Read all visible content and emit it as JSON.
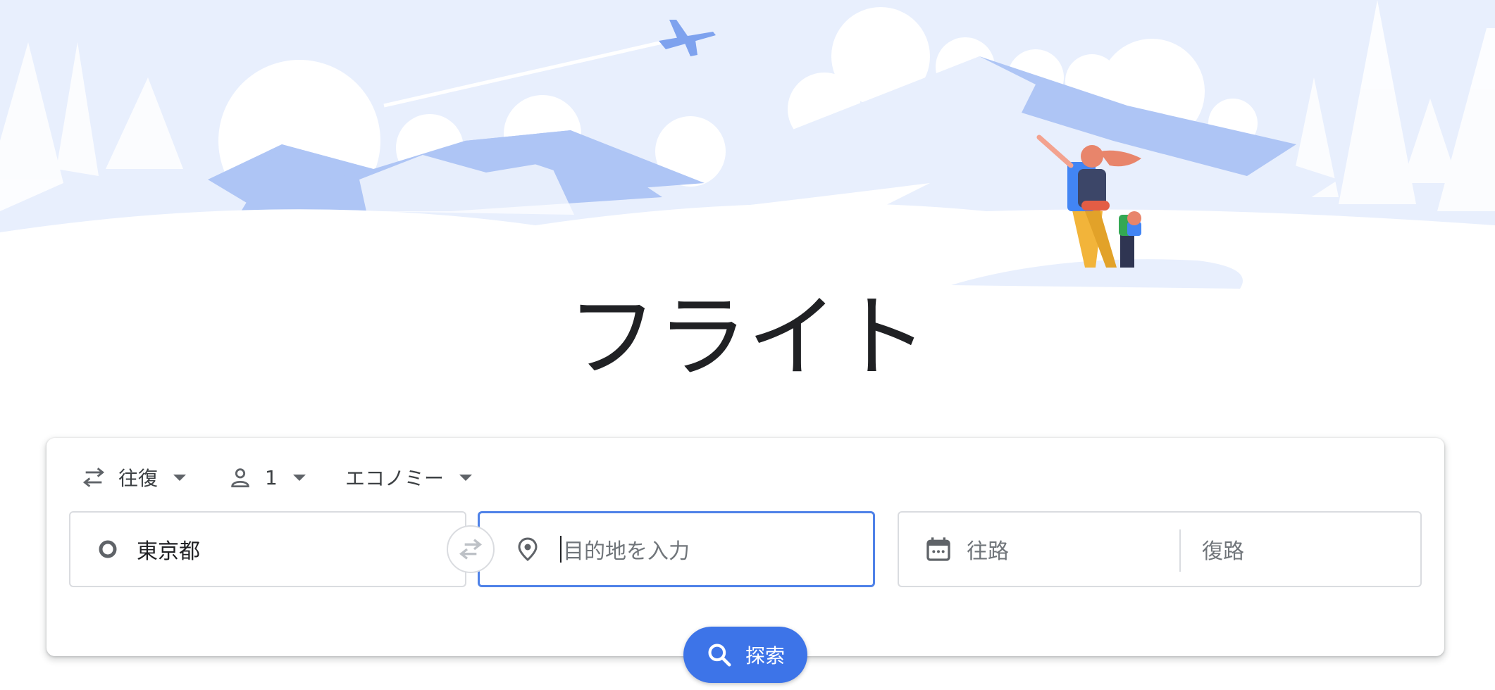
{
  "page": {
    "title": "フライト"
  },
  "trip_options": {
    "trip_type": {
      "label": "往復",
      "icon": "swap-arrows-icon"
    },
    "passengers": {
      "count": "1",
      "icon": "person-icon"
    },
    "cabin_class": {
      "label": "エコノミー"
    }
  },
  "origin": {
    "value": "東京都",
    "icon": "circle-origin-icon"
  },
  "swap": {
    "icon": "swap-horizontal-icon"
  },
  "destination": {
    "placeholder": "目的地を入力",
    "icon": "location-pin-icon"
  },
  "dates": {
    "departure_placeholder": "往路",
    "return_placeholder": "復路",
    "icon": "calendar-icon"
  },
  "search": {
    "label": "探索",
    "icon": "search-icon"
  },
  "colors": {
    "accent": "#3d74e8",
    "focus_border": "#4f82e8",
    "hero_sky": "#e8effd",
    "hero_mountain": "#aec5f5"
  }
}
